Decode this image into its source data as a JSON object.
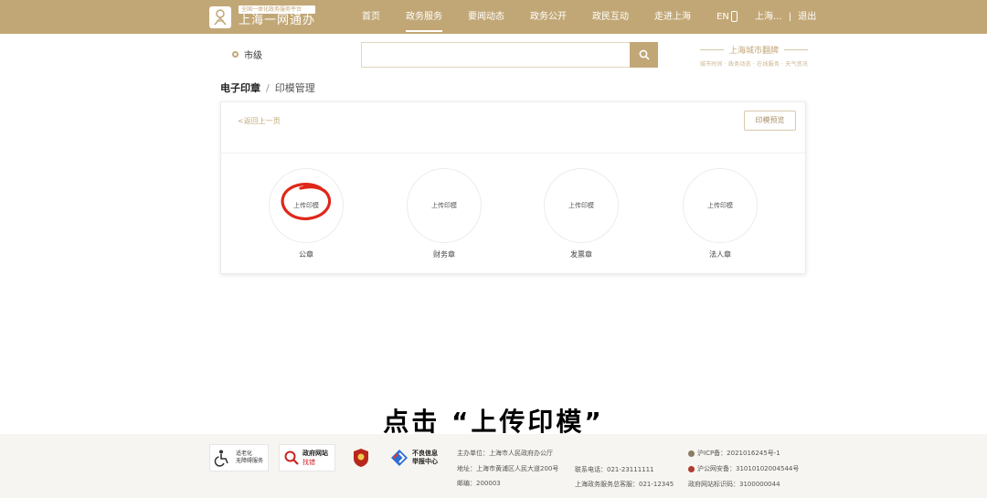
{
  "header": {
    "logo_sub": "全国一体化政务服务平台",
    "logo_main": "上海一网通办",
    "nav": [
      {
        "label": "首页",
        "active": false
      },
      {
        "label": "政务服务",
        "active": true
      },
      {
        "label": "要闻动态",
        "active": false
      },
      {
        "label": "政务公开",
        "active": false
      },
      {
        "label": "政民互动",
        "active": false
      },
      {
        "label": "走进上海",
        "active": false
      },
      {
        "label": "EN",
        "active": false
      }
    ],
    "user_text": "上海...",
    "logout": "退出"
  },
  "search": {
    "region": "市级",
    "placeholder": ""
  },
  "brand": {
    "title": "上海城市翻牌",
    "subtitle": "城市时间 · 政务动态 · 在线服务 · 天气资讯"
  },
  "breadcrumb": {
    "main": "电子印章",
    "separator": "/",
    "sub": "印模管理"
  },
  "panel": {
    "back_link": "<返回上一页",
    "preview_button": "印模预览",
    "seals": [
      {
        "button": "上传印模",
        "label": "公章"
      },
      {
        "button": "上传印模",
        "label": "财务章"
      },
      {
        "button": "上传印模",
        "label": "发票章"
      },
      {
        "button": "上传印模",
        "label": "法人章"
      }
    ]
  },
  "caption": "点击 “上传印模”",
  "footer": {
    "badge_elder": [
      "适老化",
      "无障碍服务"
    ],
    "badge_gov": [
      "政府网站",
      "找错"
    ],
    "badge_report": [
      "不良信息",
      "举报中心"
    ],
    "sponsor": "主办单位：上海市人民政府办公厅",
    "address": "地址：上海市黄浦区人民大道200号",
    "postcode": "邮编：200003",
    "phone": "联系电话：021-23111111",
    "hotline": "上海政务服务总客服：021-12345",
    "icp": "沪ICP备：2021016245号-1",
    "police": "沪公网安备：31010102004544号",
    "site_code": "政府网站标识码：3100000044"
  },
  "colors": {
    "brand_gold": "#c2a776",
    "annotation_red": "#e0271a"
  }
}
